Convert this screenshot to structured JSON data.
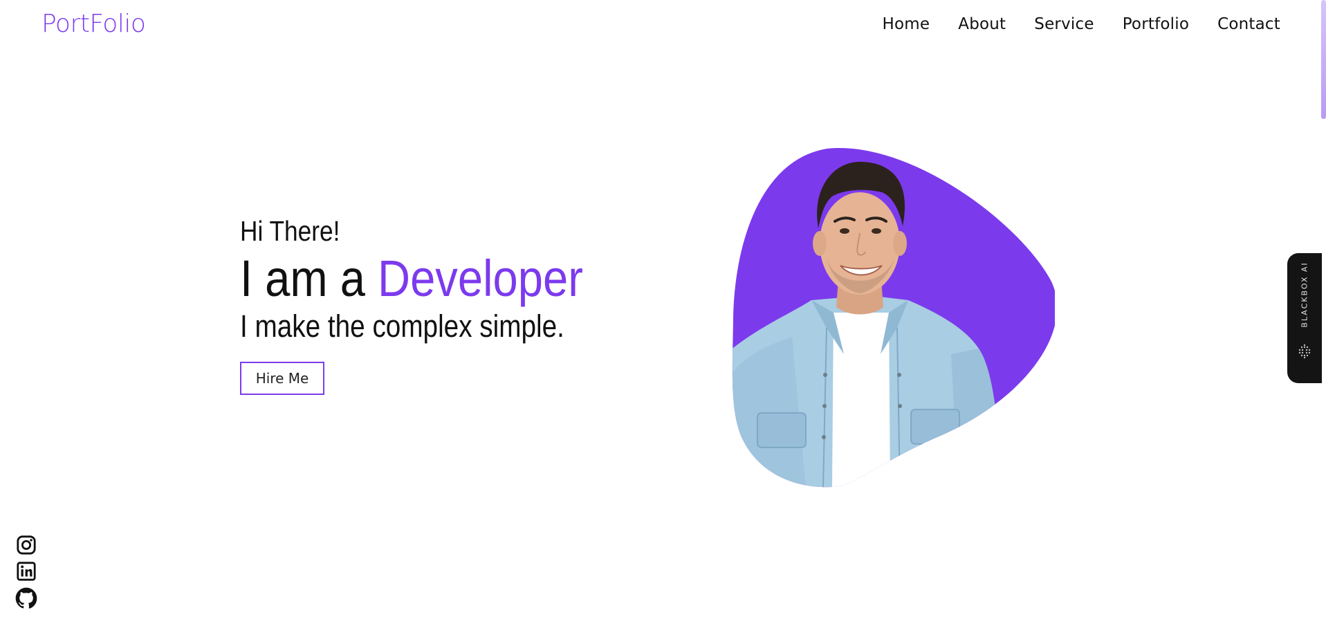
{
  "header": {
    "logo": "PortFolio",
    "nav": [
      "Home",
      "About",
      "Service",
      "Portfolio",
      "Contact"
    ]
  },
  "hero": {
    "greeting": "Hi There!",
    "headline_prefix": "I am a ",
    "headline_role": "Developer",
    "tagline": "I make the complex simple.",
    "cta_label": "Hire Me"
  },
  "social": [
    "instagram-icon",
    "linkedin-icon",
    "github-icon"
  ],
  "side_widget": {
    "label": "BLACKBOX AI"
  },
  "colors": {
    "accent": "#7c3aed",
    "text": "#111111",
    "widget_bg": "#141414",
    "shirt": "#a9cde3"
  }
}
